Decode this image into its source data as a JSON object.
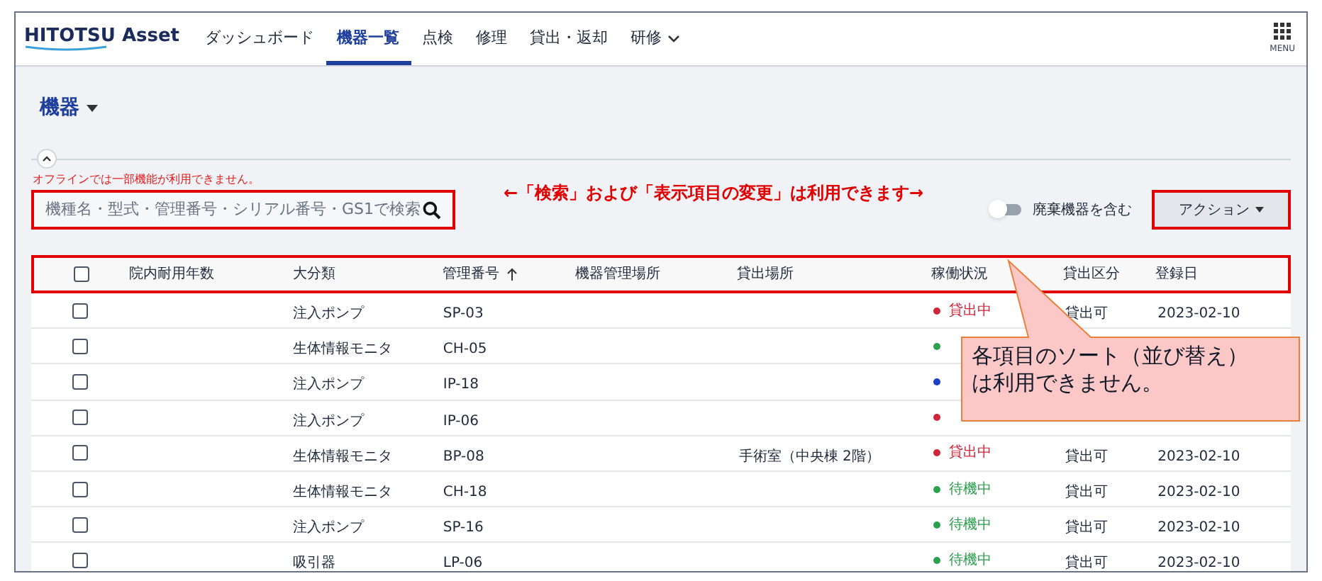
{
  "app": {
    "logo": "HITOTSU Asset",
    "menu_label": "MENU"
  },
  "nav": [
    {
      "label": "ダッシュボード",
      "selected": false
    },
    {
      "label": "機器一覧",
      "selected": true
    },
    {
      "label": "点検",
      "selected": false
    },
    {
      "label": "修理",
      "selected": false
    },
    {
      "label": "貸出・返却",
      "selected": false
    },
    {
      "label": "研修",
      "selected": false,
      "dropdown": true
    }
  ],
  "page_title": "機器",
  "offline_notice": "オフラインでは一部機能が利用できません。",
  "search": {
    "placeholder": "機種名・型式・管理番号・シリアル番号・GS1で検索"
  },
  "annotation_note": "←「検索」および「表示項目の変更」は利用できます→",
  "discarded_toggle": {
    "label": "廃棄機器を含む",
    "on": false
  },
  "action_button": "アクション",
  "table": {
    "header_checked": false,
    "columns": [
      {
        "label": "院内耐用年数"
      },
      {
        "label": "大分類"
      },
      {
        "label": "管理番号",
        "sorted": true
      },
      {
        "label": "機器管理場所"
      },
      {
        "label": "貸出場所"
      },
      {
        "label": "稼働状況"
      },
      {
        "label": "貸出区分"
      },
      {
        "label": "登録日"
      }
    ],
    "rows": [
      {
        "checked": false,
        "category": "注入ポンプ",
        "id": "SP-03",
        "status": "貸出中",
        "color": "#d0253a",
        "lending": "貸出可",
        "date": "2023-02-10"
      },
      {
        "checked": false,
        "category": "生体情報モニタ",
        "id": "CH-05",
        "color": "#2e9e4f"
      },
      {
        "checked": false,
        "category": "注入ポンプ",
        "id": "IP-18",
        "color": "#1f3fc4"
      },
      {
        "checked": false,
        "category": "注入ポンプ",
        "id": "IP-06",
        "color": "#d0253a"
      },
      {
        "checked": false,
        "category": "生体情報モニタ",
        "id": "BP-08",
        "location": "手術室（中央棟 2階）",
        "status": "貸出中",
        "color": "#d0253a",
        "lending": "貸出可",
        "date": "2023-02-10"
      },
      {
        "checked": false,
        "category": "生体情報モニタ",
        "id": "CH-18",
        "status": "待機中",
        "color": "#2e9e4f",
        "lending": "貸出可",
        "date": "2023-02-10"
      },
      {
        "checked": false,
        "category": "注入ポンプ",
        "id": "SP-16",
        "status": "待機中",
        "color": "#2e9e4f",
        "lending": "貸出可",
        "date": "2023-02-10"
      },
      {
        "checked": false,
        "category": "吸引器",
        "id": "LP-06",
        "status": "待機中",
        "color": "#2e9e4f",
        "lending": "貸出可",
        "date": "2023-02-10"
      }
    ]
  },
  "callout": "各項目のソート（並び替え）は利用できません。"
}
